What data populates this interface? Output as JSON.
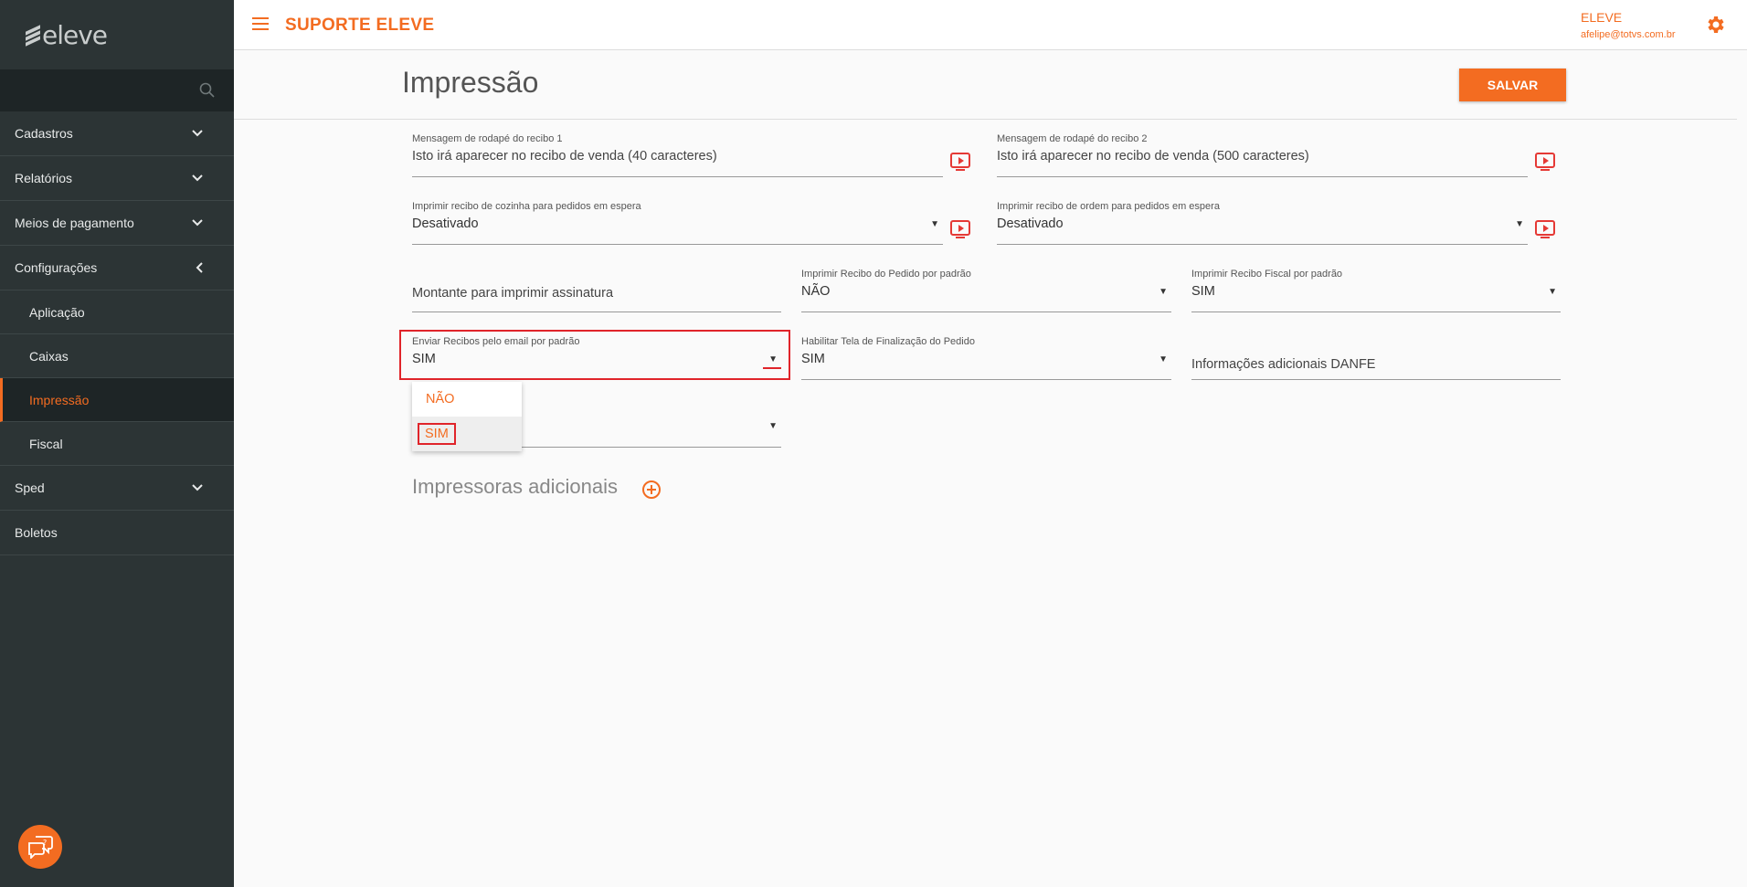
{
  "sidebar": {
    "logo": "eleve",
    "items": [
      {
        "label": "Cadastros"
      },
      {
        "label": "Relatórios"
      },
      {
        "label": "Meios de pagamento"
      },
      {
        "label": "Configurações"
      }
    ],
    "sub_items": [
      {
        "label": "Aplicação"
      },
      {
        "label": "Caixas"
      },
      {
        "label": "Impressão"
      },
      {
        "label": "Fiscal"
      }
    ],
    "bottom_items": [
      {
        "label": "Sped"
      },
      {
        "label": "Boletos"
      }
    ]
  },
  "topbar": {
    "title": "SUPORTE ELEVE",
    "user_name": "ELEVE",
    "user_email": "afelipe@totvs.com.br"
  },
  "page": {
    "title": "Impressão",
    "save_label": "SALVAR"
  },
  "form": {
    "footer1": {
      "label": "Mensagem de rodapé do recibo 1",
      "placeholder": "Isto irá aparecer no recibo de venda (40 caracteres)"
    },
    "footer2": {
      "label": "Mensagem de rodapé do recibo 2",
      "placeholder": "Isto irá aparecer no recibo de venda (500 caracteres)"
    },
    "kitchen": {
      "label": "Imprimir recibo de cozinha para pedidos em espera",
      "value": "Desativado"
    },
    "order": {
      "label": "Imprimir recibo de ordem para pedidos em espera",
      "value": "Desativado"
    },
    "signature": {
      "placeholder": "Montante para imprimir assinatura"
    },
    "order_default": {
      "label": "Imprimir Recibo do Pedido por padrão",
      "value": "NÃO"
    },
    "fiscal_default": {
      "label": "Imprimir Recibo Fiscal por padrão",
      "value": "SIM"
    },
    "email_default": {
      "label": "Enviar Recibos pelo email por padrão",
      "value": "SIM"
    },
    "finish_screen": {
      "label": "Habilitar Tela de Finalização do Pedido",
      "value": "SIM"
    },
    "danfe": {
      "placeholder": "Informações adicionais DANFE"
    }
  },
  "dropdown": {
    "options": [
      "NÃO",
      "SIM"
    ],
    "selected": "SIM"
  },
  "section": {
    "title": "Impressoras adicionais"
  },
  "colors": {
    "accent": "#f36c21",
    "sidebar_bg": "#2c3435",
    "highlight": "#e0242a"
  }
}
